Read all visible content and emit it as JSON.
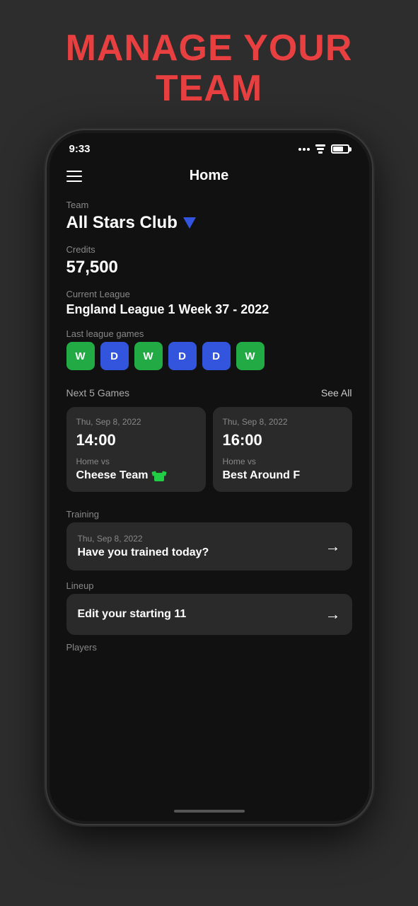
{
  "page": {
    "title": "MANAGE YOUR\nTEAM",
    "title_line1": "MANAGE YOUR",
    "title_line2": "TEAM"
  },
  "status_bar": {
    "time": "9:33",
    "wifi": true,
    "battery_pct": 70
  },
  "nav": {
    "title": "Home",
    "hamburger_label": "menu"
  },
  "team": {
    "label": "Team",
    "name": "All Stars Club",
    "credits_label": "Credits",
    "credits_value": "57,500",
    "league_label": "Current League",
    "league_name": "England League 1 Week 37 - 2022",
    "last_games_label": "Last league games",
    "results": [
      {
        "result": "W",
        "type": "win"
      },
      {
        "result": "D",
        "type": "draw"
      },
      {
        "result": "W",
        "type": "win"
      },
      {
        "result": "D",
        "type": "draw"
      },
      {
        "result": "D",
        "type": "draw"
      },
      {
        "result": "W",
        "type": "win"
      }
    ]
  },
  "next_games": {
    "label": "Next 5 Games",
    "see_all": "See All",
    "games": [
      {
        "date": "Thu, Sep 8, 2022",
        "time": "14:00",
        "vs_label": "Home vs",
        "opponent": "Cheese Team",
        "has_jersey": true
      },
      {
        "date": "Thu, Sep 8, 2022",
        "time": "16:00",
        "vs_label": "Home vs",
        "opponent": "Best Around F",
        "has_jersey": false
      }
    ]
  },
  "training": {
    "label": "Training",
    "card_date": "Thu, Sep 8, 2022",
    "card_text": "Have you trained today?",
    "arrow": "→"
  },
  "lineup": {
    "label": "Lineup",
    "card_text": "Edit your starting 11",
    "arrow": "→"
  },
  "players": {
    "label": "Players"
  }
}
